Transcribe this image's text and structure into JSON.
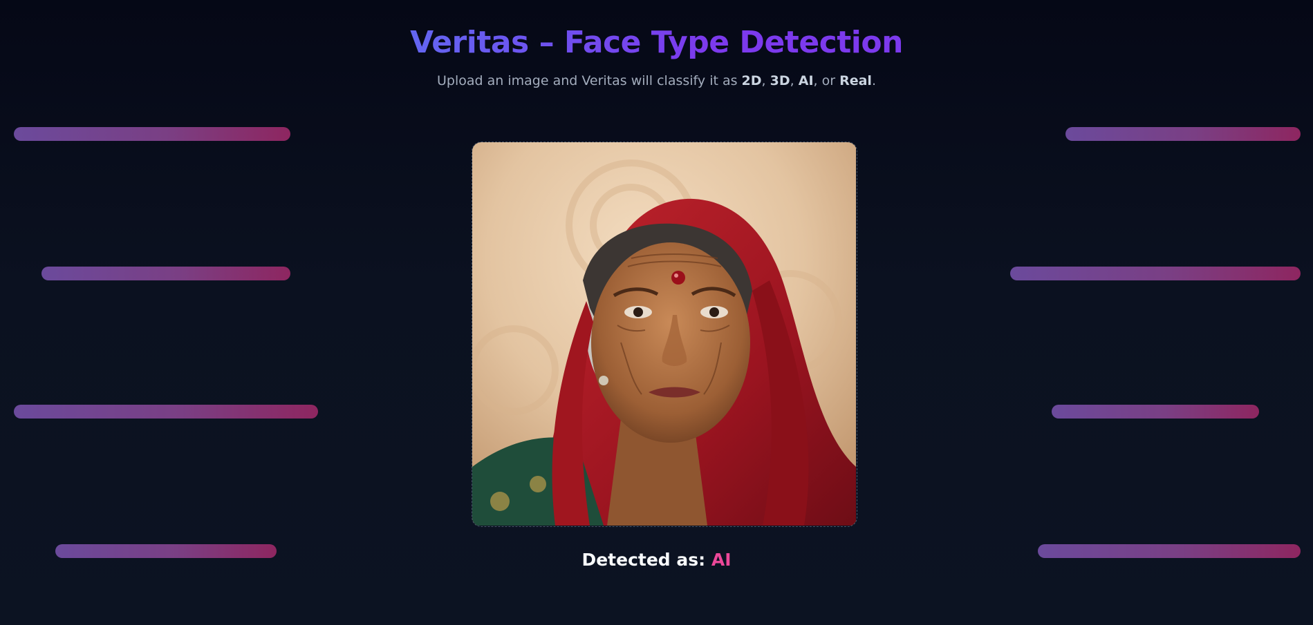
{
  "header": {
    "title": "Veritas – Face Type Detection",
    "subtitle_prefix": "Upload an image and Veritas will classify it as ",
    "types": [
      "2D",
      "3D",
      "AI",
      "Real"
    ],
    "sep1": ", ",
    "sep2": ", ",
    "sep3": ", or ",
    "subtitle_suffix": "."
  },
  "upload": {
    "image_alt": "uploaded portrait of an elderly woman in a red headscarf"
  },
  "result": {
    "label": "Detected as: ",
    "value": "AI"
  },
  "colors": {
    "accent_title": "#6366f1",
    "result_value": "#ec4899",
    "bar_start": "#6b4a9c",
    "bar_end": "#8e2660"
  }
}
